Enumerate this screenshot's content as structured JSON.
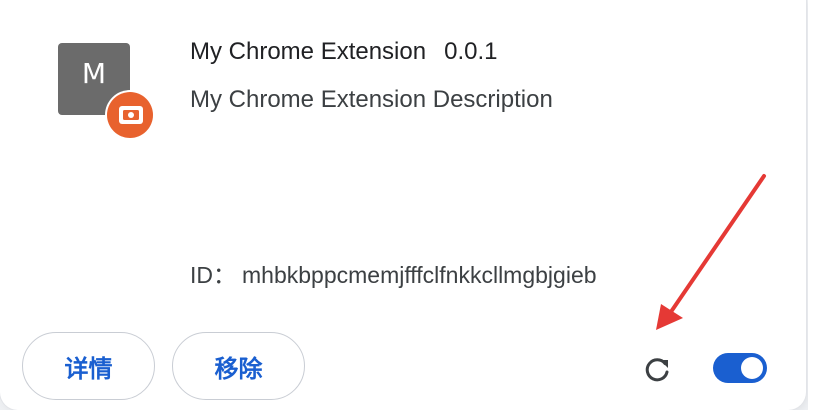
{
  "extension": {
    "icon_letter": "M",
    "name": "My Chrome Extension",
    "version": "0.0.1",
    "description": "My Chrome Extension Description",
    "id_label": "ID：",
    "id_value": "mhbkbppcmemjfffclfnkkcllmgbjgieb",
    "enabled": true
  },
  "actions": {
    "details_label": "详情",
    "remove_label": "移除"
  },
  "icons": {
    "badge": "screen-capture-badge-icon",
    "reload": "reload-icon"
  },
  "colors": {
    "accent": "#1a5fd0",
    "badge": "#e8622e",
    "icon_bg": "#6b6b6b",
    "annotation": "#e53935"
  }
}
